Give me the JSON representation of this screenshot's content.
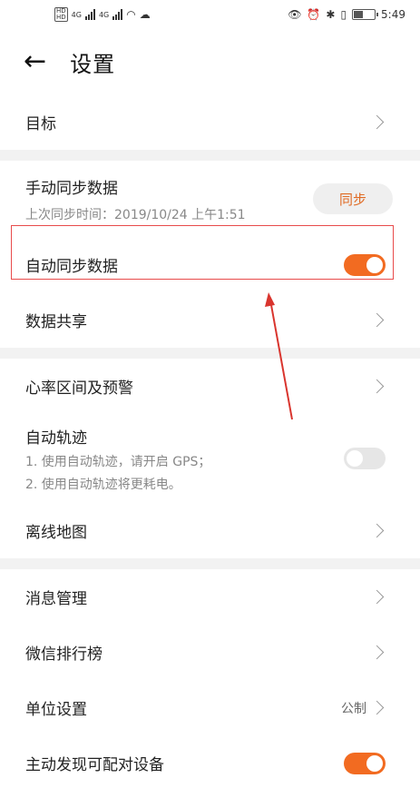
{
  "statusbar": {
    "hd_top": "HD",
    "hd_bottom": "HD",
    "network1": "4G",
    "network2": "4G",
    "time": "5:49"
  },
  "header": {
    "title": "设置"
  },
  "rows": {
    "goal": "目标",
    "manual_sync_title": "手动同步数据",
    "manual_sync_subtitle": "上次同步时间：2019/10/24 上午1:51",
    "sync_button": "同步",
    "auto_sync": "自动同步数据",
    "data_share": "数据共享",
    "heart_rate": "心率区间及预警",
    "auto_track_title": "自动轨迹",
    "auto_track_line1": "1. 使用自动轨迹，请开启 GPS；",
    "auto_track_line2": "2. 使用自动轨迹将更耗电。",
    "offline_map": "离线地图",
    "message_mgmt": "消息管理",
    "wechat_rank": "微信排行榜",
    "unit_settings": "单位设置",
    "unit_value": "公制",
    "discover_devices": "主动发现可配对设备"
  },
  "toggles": {
    "auto_sync": "on",
    "auto_track": "off",
    "discover_devices": "on"
  },
  "colors": {
    "accent": "#f26b21",
    "highlight": "#e84b4b"
  }
}
